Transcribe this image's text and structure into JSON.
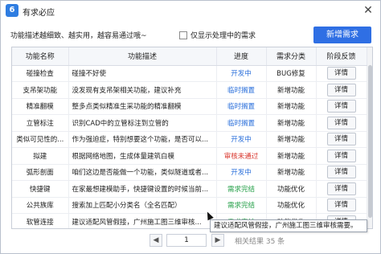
{
  "window": {
    "icon_glyph": "6",
    "title": "有求必应",
    "close_glyph": "✕"
  },
  "toolbar": {
    "hint": "功能描述越细致、越实用，越容易通过哦~",
    "filter_label": "仅显示处理中的需求",
    "new_button": "新增需求"
  },
  "table": {
    "headers": [
      "功能名称",
      "功能描述",
      "进度",
      "需求分类",
      "阶段反馈"
    ],
    "rows": [
      {
        "name": "碰撞检查",
        "desc": "碰撞不好使",
        "status": "开发中",
        "status_color": "blue",
        "category": "BUG修复",
        "action": "详情"
      },
      {
        "name": "支吊架功能",
        "desc": "没发现有支吊架相关功能，建议补充",
        "status": "临时搁置",
        "status_color": "blue",
        "category": "新增功能",
        "action": "详情"
      },
      {
        "name": "精准翻模",
        "desc": "整多点类似精准生采功能的精准翻模",
        "status": "临时搁置",
        "status_color": "blue",
        "category": "新增功能",
        "action": "详情"
      },
      {
        "name": "立管标注",
        "desc": "识别CAD中的立管标注到立管的",
        "status": "临时搁置",
        "status_color": "blue",
        "category": "新增功能",
        "action": "详情"
      },
      {
        "name": "类似可见性的...",
        "desc": "作为强迫症，特别想要这个功能，是否可以...",
        "status": "开发中",
        "status_color": "blue",
        "category": "新增功能",
        "action": "详情"
      },
      {
        "name": "拟建",
        "desc": "根据网络地图，生成体量建筑白模",
        "status": "审核未通过",
        "status_color": "red",
        "category": "新增功能",
        "action": "详情"
      },
      {
        "name": "弧形剖面",
        "desc": "咱们这边是否能做一个功能，类似隧道或者...",
        "status": "开发中",
        "status_color": "blue",
        "category": "新增功能",
        "action": "详情"
      },
      {
        "name": "快捷键",
        "desc": "在家最想建模助手，快捷键设置的时候当前...",
        "status": "需求完结",
        "status_color": "green",
        "category": "功能优化",
        "action": "详情"
      },
      {
        "name": "公共族库",
        "desc": "搜索加上匹配小分类名（全名匹配）",
        "status": "需求完结",
        "status_color": "green",
        "category": "功能优化",
        "action": "详情"
      },
      {
        "name": "软管连接",
        "desc": "建议适配风管假接，广州施工图三维审核...",
        "status": "需求完结",
        "status_color": "green",
        "category": "功能优化",
        "action": "详情"
      }
    ]
  },
  "tooltip": {
    "text": "建议适配风管假接，广州施工图三维审核需要。"
  },
  "pager": {
    "prev_glyph": "◀",
    "next_glyph": "▶",
    "current_page": "1",
    "result_text": "相关结果 35 条"
  },
  "colors": {
    "accent": "#2f6fe4",
    "status_blue": "#2a6fdb",
    "status_green": "#26a04a",
    "status_red": "#d9342b"
  }
}
